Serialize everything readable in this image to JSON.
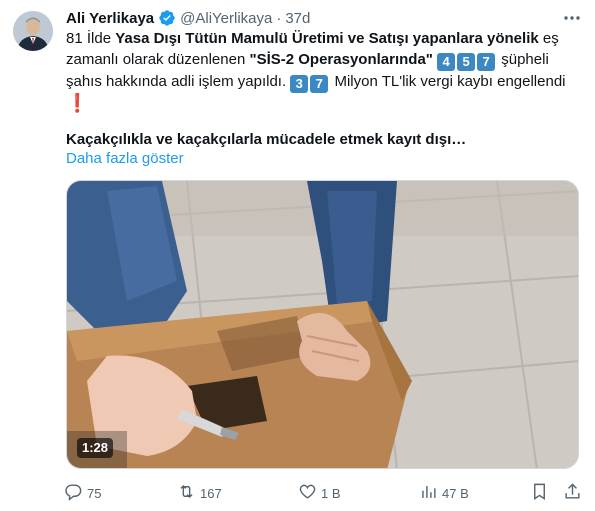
{
  "author": {
    "name": "Ali Yerlikaya",
    "handle": "@AliYerlikaya",
    "separator": "·",
    "time": "37d"
  },
  "tweet": {
    "line1_a": "81 İlde ",
    "line1_b": "Yasa Dışı Tütün Mamulü Üretimi ve Satışı yapanlara yönelik",
    "line1_c": " eş",
    "line2_a": "zamanlı olarak düzenlenen ",
    "line2_b": "\"SİS-2 Operasyonlarında\"",
    "num1": [
      "4",
      "5",
      "7"
    ],
    "line2_c": "şüpheli",
    "line3_a": "şahıs hakkında adli işlem yapıldı. ",
    "num2": [
      "3",
      "7"
    ],
    "line3_b": "Milyon TL'lik vergi kaybı engellendi",
    "exclamation": "❗",
    "headline": "Kaçakçılıkla ve kaçakçılarla mücadele etmek kayıt dışı…",
    "show_more": "Daha fazla göster"
  },
  "media": {
    "type": "video",
    "duration": "1:28"
  },
  "actions": {
    "replies": "75",
    "reposts": "167",
    "likes": "1 B",
    "views": "47 B"
  },
  "colors": {
    "accent": "#1d9bf0",
    "muted": "#536471",
    "keycap": "#3b88c3"
  }
}
